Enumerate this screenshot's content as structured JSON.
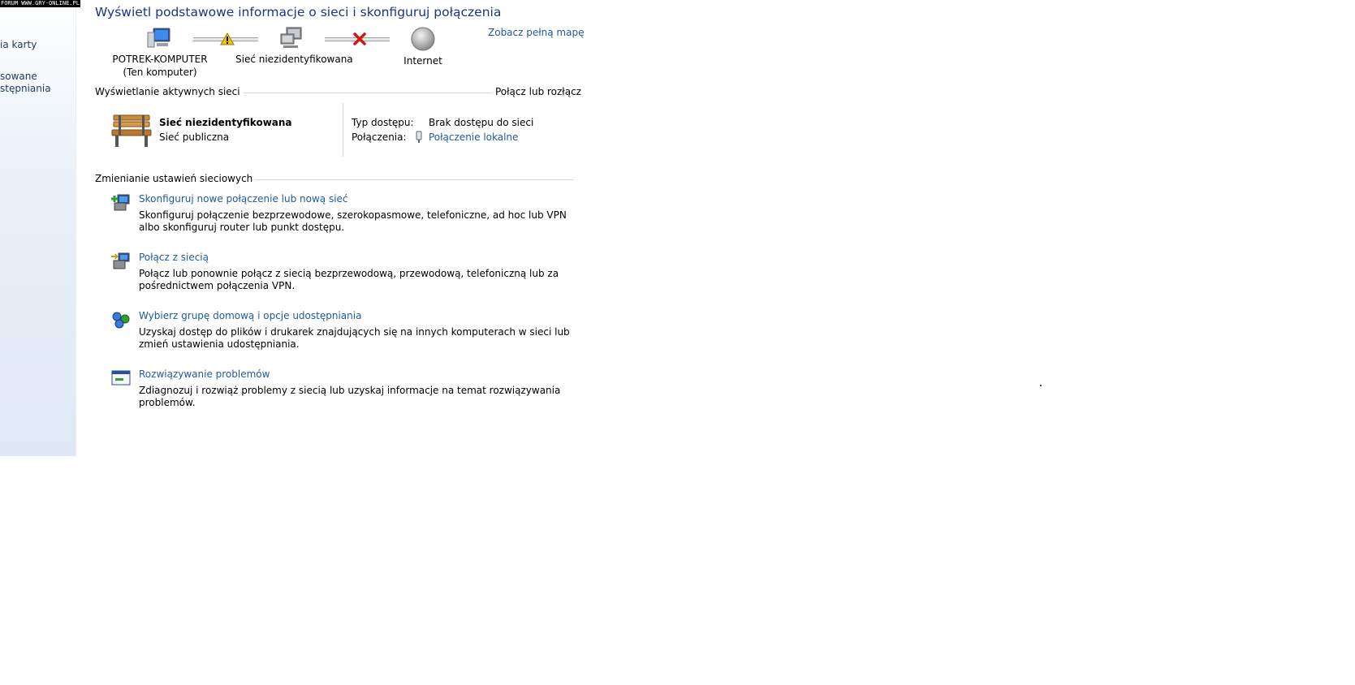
{
  "watermark": "FORUM WWW.GRY-ONLINE.PL",
  "sidebar": {
    "items": [
      "ia karty",
      "sowane",
      "stępniania"
    ]
  },
  "page_title": "Wyświetl podstawowe informacje o sieci i skonfiguruj połączenia",
  "full_map_link": "Zobacz pełną mapę",
  "network_map": {
    "computer_name": "POTREK-KOMPUTER",
    "computer_sub": "(Ten komputer)",
    "network_name": "Sieć niezidentyfikowana",
    "internet": "Internet"
  },
  "active_networks": {
    "header": "Wyświetlanie aktywnych sieci",
    "connect_link": "Połącz lub rozłącz",
    "network_title": "Sieć niezidentyfikowana",
    "network_type": "Sieć publiczna",
    "access_type_label": "Typ dostępu:",
    "access_type_value": "Brak dostępu do sieci",
    "connections_label": "Połączenia:",
    "connections_value": "Połączenie lokalne"
  },
  "change_settings": {
    "header": "Zmienianie ustawień sieciowych",
    "tasks": [
      {
        "link": "Skonfiguruj nowe połączenie lub nową sieć",
        "desc": "Skonfiguruj połączenie bezprzewodowe, szerokopasmowe, telefoniczne, ad hoc lub VPN albo skonfiguruj router lub punkt dostępu."
      },
      {
        "link": "Połącz z siecią",
        "desc": "Połącz lub ponownie połącz z siecią bezprzewodową, przewodową, telefoniczną lub za pośrednictwem połączenia VPN."
      },
      {
        "link": "Wybierz grupę domową i opcje udostępniania",
        "desc": "Uzyskaj dostęp do plików i drukarek znajdujących się na innych komputerach w sieci lub zmień ustawienia udostępniania."
      },
      {
        "link": "Rozwiązywanie problemów",
        "desc": "Zdiagnozuj i rozwiąż problemy z siecią lub uzyskaj informacje na temat rozwiązywania problemów."
      }
    ]
  }
}
